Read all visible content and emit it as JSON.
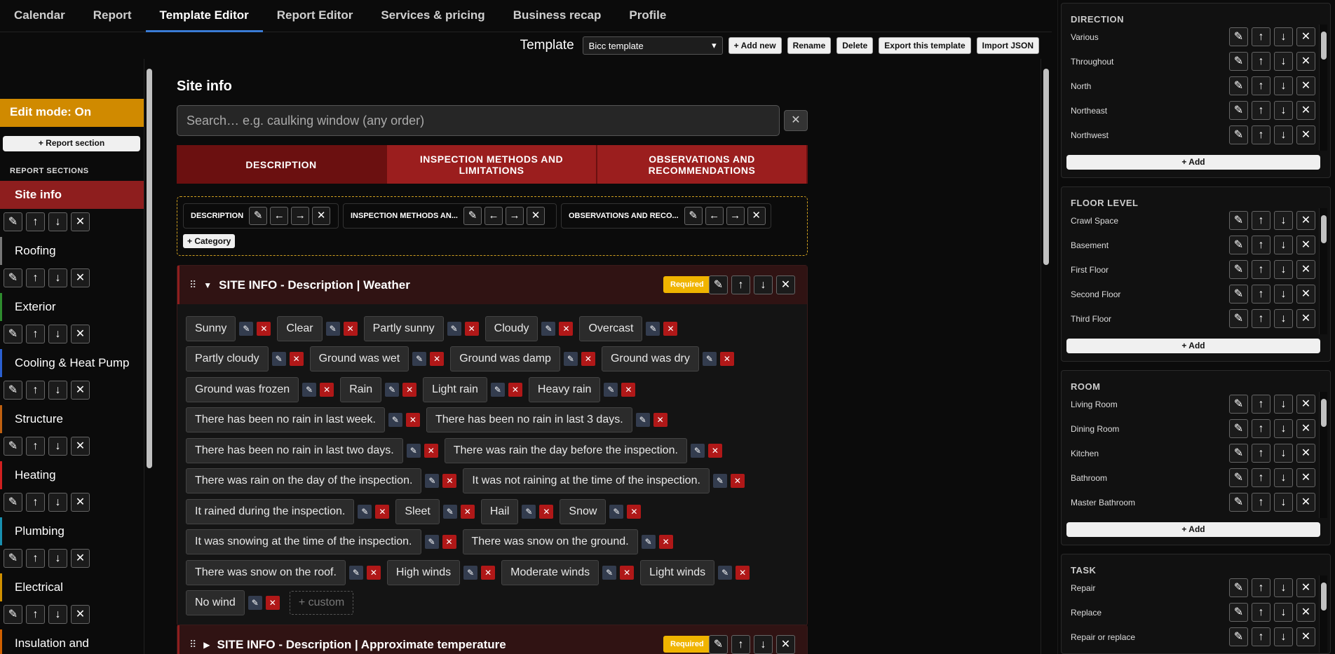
{
  "nav": {
    "tabs": [
      "Calendar",
      "Report",
      "Template Editor",
      "Report Editor",
      "Services & pricing",
      "Business recap",
      "Profile"
    ]
  },
  "toolbar": {
    "label": "Template",
    "selected": "Bicc template",
    "add_new": "+ Add new",
    "rename": "Rename",
    "delete": "Delete",
    "export": "Export this template",
    "import": "Import JSON"
  },
  "sidebar": {
    "edit_mode": "Edit mode: On",
    "add_section": "+ Report section",
    "sections_heading": "REPORT SECTIONS",
    "sections": [
      {
        "label": "Site info",
        "color": "#8e1e1e"
      },
      {
        "label": "Roofing",
        "color": "#777777"
      },
      {
        "label": "Exterior",
        "color": "#2e8b2e"
      },
      {
        "label": "Cooling & Heat Pump",
        "color": "#2a5fd0"
      },
      {
        "label": "Structure",
        "color": "#c06010"
      },
      {
        "label": "Heating",
        "color": "#d02020"
      },
      {
        "label": "Plumbing",
        "color": "#1890b0"
      },
      {
        "label": "Electrical",
        "color": "#d09000"
      },
      {
        "label": "Insulation and",
        "color": "#d06000"
      }
    ]
  },
  "main": {
    "title": "Site info",
    "search_placeholder": "Search… e.g. caulking window (any order)",
    "tabs": [
      "DESCRIPTION",
      "INSPECTION METHODS AND LIMITATIONS",
      "OBSERVATIONS AND RECOMMENDATIONS"
    ],
    "categories": [
      "DESCRIPTION",
      "INSPECTION METHODS AN...",
      "OBSERVATIONS AND RECO..."
    ],
    "add_category": "+ Category",
    "panel1": {
      "title": "SITE INFO - Description | Weather",
      "required": "Required",
      "rows": [
        [
          "Sunny",
          "Clear",
          "Partly sunny",
          "Cloudy",
          "Overcast"
        ],
        [
          "Partly cloudy",
          "Ground was wet",
          "Ground was damp",
          "Ground was dry"
        ],
        [
          "Ground was frozen",
          "Rain",
          "Light rain",
          "Heavy rain"
        ],
        [
          "There has been no rain in last week.",
          "There has been no rain in last 3 days."
        ],
        [
          "There has been no rain in last two days.",
          "There was rain the day before the inspection."
        ],
        [
          "There was rain on the day of the inspection.",
          "It was not raining at the time of the inspection."
        ],
        [
          "It rained during the inspection.",
          "Sleet",
          "Hail",
          "Snow"
        ],
        [
          "It was snowing at the time of the inspection.",
          "There was snow on the ground."
        ],
        [
          "There was snow on the roof.",
          "High winds",
          "Moderate winds",
          "Light winds"
        ],
        [
          "No wind"
        ]
      ],
      "custom": "+ custom"
    },
    "panel2": {
      "title": "SITE INFO - Description | Approximate temperature",
      "required": "Required"
    }
  },
  "right": {
    "panels": [
      {
        "heading": "DIRECTION",
        "items": [
          "Various",
          "Throughout",
          "North",
          "Northeast",
          "Northwest"
        ],
        "add": "+ Add"
      },
      {
        "heading": "FLOOR LEVEL",
        "items": [
          "Crawl Space",
          "Basement",
          "First Floor",
          "Second Floor",
          "Third Floor"
        ],
        "add": "+ Add"
      },
      {
        "heading": "ROOM",
        "items": [
          "Living Room",
          "Dining Room",
          "Kitchen",
          "Bathroom",
          "Master Bathroom"
        ],
        "add": "+ Add"
      },
      {
        "heading": "TASK",
        "items": [
          "Repair",
          "Replace",
          "Repair or replace"
        ]
      }
    ]
  },
  "icons": {
    "edit": "pencil-icon",
    "up": "arrow-up-icon",
    "down": "arrow-down-icon",
    "delete": "close-icon",
    "left": "arrow-left-icon",
    "right": "arrow-right-icon"
  }
}
